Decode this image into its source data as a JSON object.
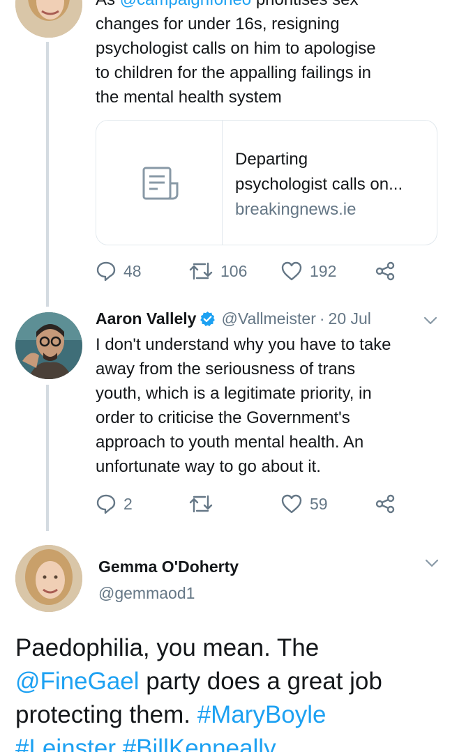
{
  "first_tweet": {
    "text_mention": "@campaignforleo",
    "text_rest_line1": " prioritises sex",
    "text_lines": [
      "changes for under 16s, resigning",
      "psychologist calls on him to apologise",
      "to children for the appalling failings in",
      "the mental health system"
    ],
    "text_prefix": "As ",
    "card": {
      "title_line1": "Departing",
      "title_line2": "psychologist calls on...",
      "domain": "breakingnews.ie",
      "thumb_icon": "article-icon"
    },
    "replies": "48",
    "retweets": "106",
    "likes": "192"
  },
  "second_tweet": {
    "name": "Aaron Vallely",
    "verified": true,
    "handle": "@Vallmeister",
    "separator": "·",
    "date": "20 Jul",
    "text_lines": [
      "I don't understand why you have to take",
      "away from the seriousness of trans",
      "youth, which is a legitimate priority, in",
      "order to criticise the Government's",
      "approach to youth mental health. An",
      "unfortunate way to go about it."
    ],
    "replies": "2",
    "retweets": "",
    "likes": "59"
  },
  "main_tweet": {
    "name": "Gemma O'Doherty",
    "handle": "@gemmaod1",
    "line1": "Paedophilia, you mean. The",
    "line2_mention": "@FineGael",
    "line2_rest": " party does a great job",
    "line3_text": "protecting them. ",
    "line3_tag": "#MaryBoyle",
    "line4_tag1": "#Leinster",
    "line4_tag2": "#BillKenneally"
  },
  "colors": {
    "link": "#1da1f2",
    "secondary_text": "#657786",
    "thread_line": "#d4dbe1",
    "border": "#e1e8ed"
  }
}
